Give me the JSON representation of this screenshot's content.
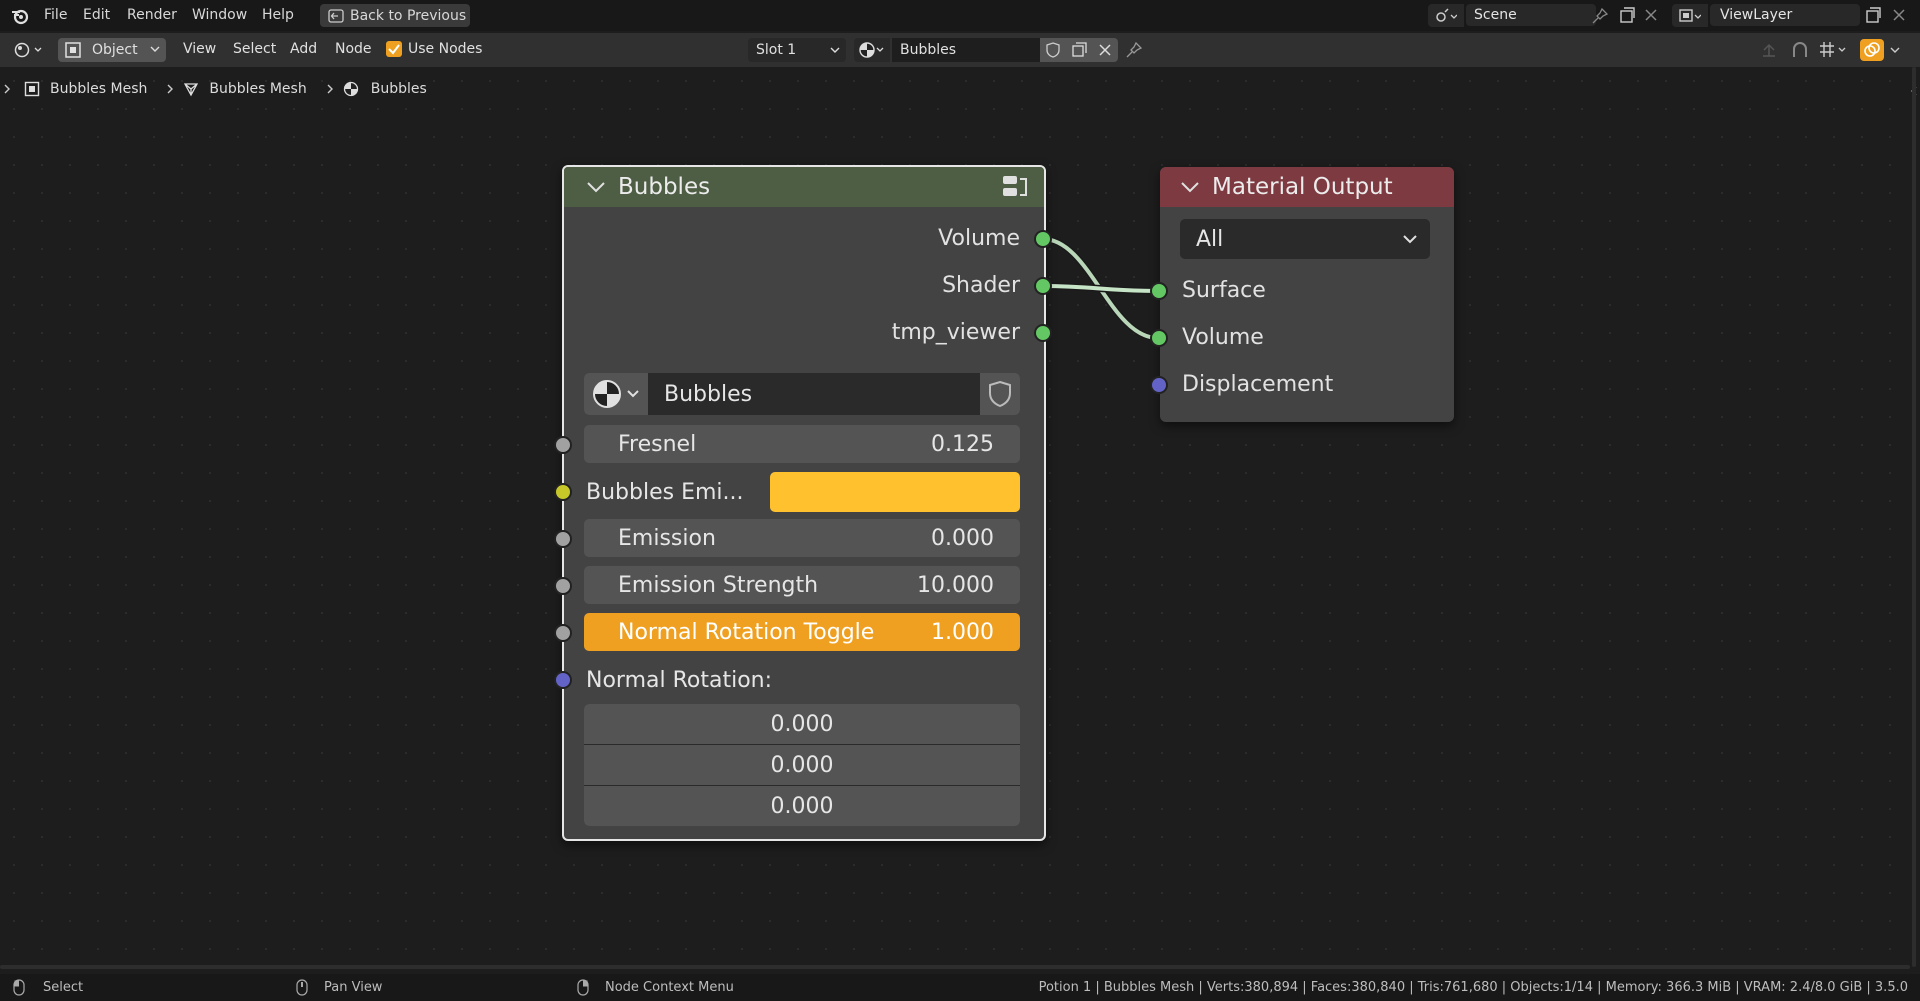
{
  "menu": {
    "file": "File",
    "edit": "Edit",
    "render": "Render",
    "window": "Window",
    "help": "Help",
    "back_to_previous": "Back to Previous",
    "scene": "Scene",
    "view_layer": "ViewLayer"
  },
  "header": {
    "mode": "Object",
    "view": "View",
    "select": "Select",
    "add": "Add",
    "node": "Node",
    "use_nodes": "Use Nodes",
    "slot": "Slot 1",
    "material": "Bubbles"
  },
  "breadcrumb": {
    "object": "Bubbles Mesh",
    "mesh": "Bubbles Mesh",
    "material": "Bubbles"
  },
  "group_node": {
    "title": "Bubbles",
    "outputs": [
      "Volume",
      "Shader",
      "tmp_viewer"
    ],
    "datablock": "Bubbles",
    "inputs": {
      "fresnel_label": "Fresnel",
      "fresnel_value": "0.125",
      "emission_color_label": "Bubbles Emi...",
      "emission_color": "#ffc22e",
      "emission_label": "Emission",
      "emission_value": "0.000",
      "emission_strength_label": "Emission Strength",
      "emission_strength_value": "10.000",
      "normal_toggle_label": "Normal Rotation Toggle",
      "normal_toggle_value": "1.000",
      "normal_rotation_label": "Normal Rotation:",
      "normal_rotation_values": [
        "0.000",
        "0.000",
        "0.000"
      ]
    }
  },
  "output_node": {
    "title": "Material Output",
    "target": "All",
    "inputs": [
      "Surface",
      "Volume",
      "Displacement"
    ]
  },
  "statusbar": {
    "select": "Select",
    "pan_view": "Pan View",
    "context_menu": "Node Context Menu",
    "stats": "Potion 1 | Bubbles Mesh | Verts:380,894 | Faces:380,840 | Tris:761,680 | Objects:1/14 | Memory: 366.3 MiB | VRAM: 2.4/8.0 GiB | 3.5.0"
  },
  "colors": {
    "accent": "#f0a020",
    "socket_shader": "#63c763",
    "socket_float": "#a1a1a1",
    "socket_color": "#c7c729",
    "socket_vector": "#6363c7"
  }
}
